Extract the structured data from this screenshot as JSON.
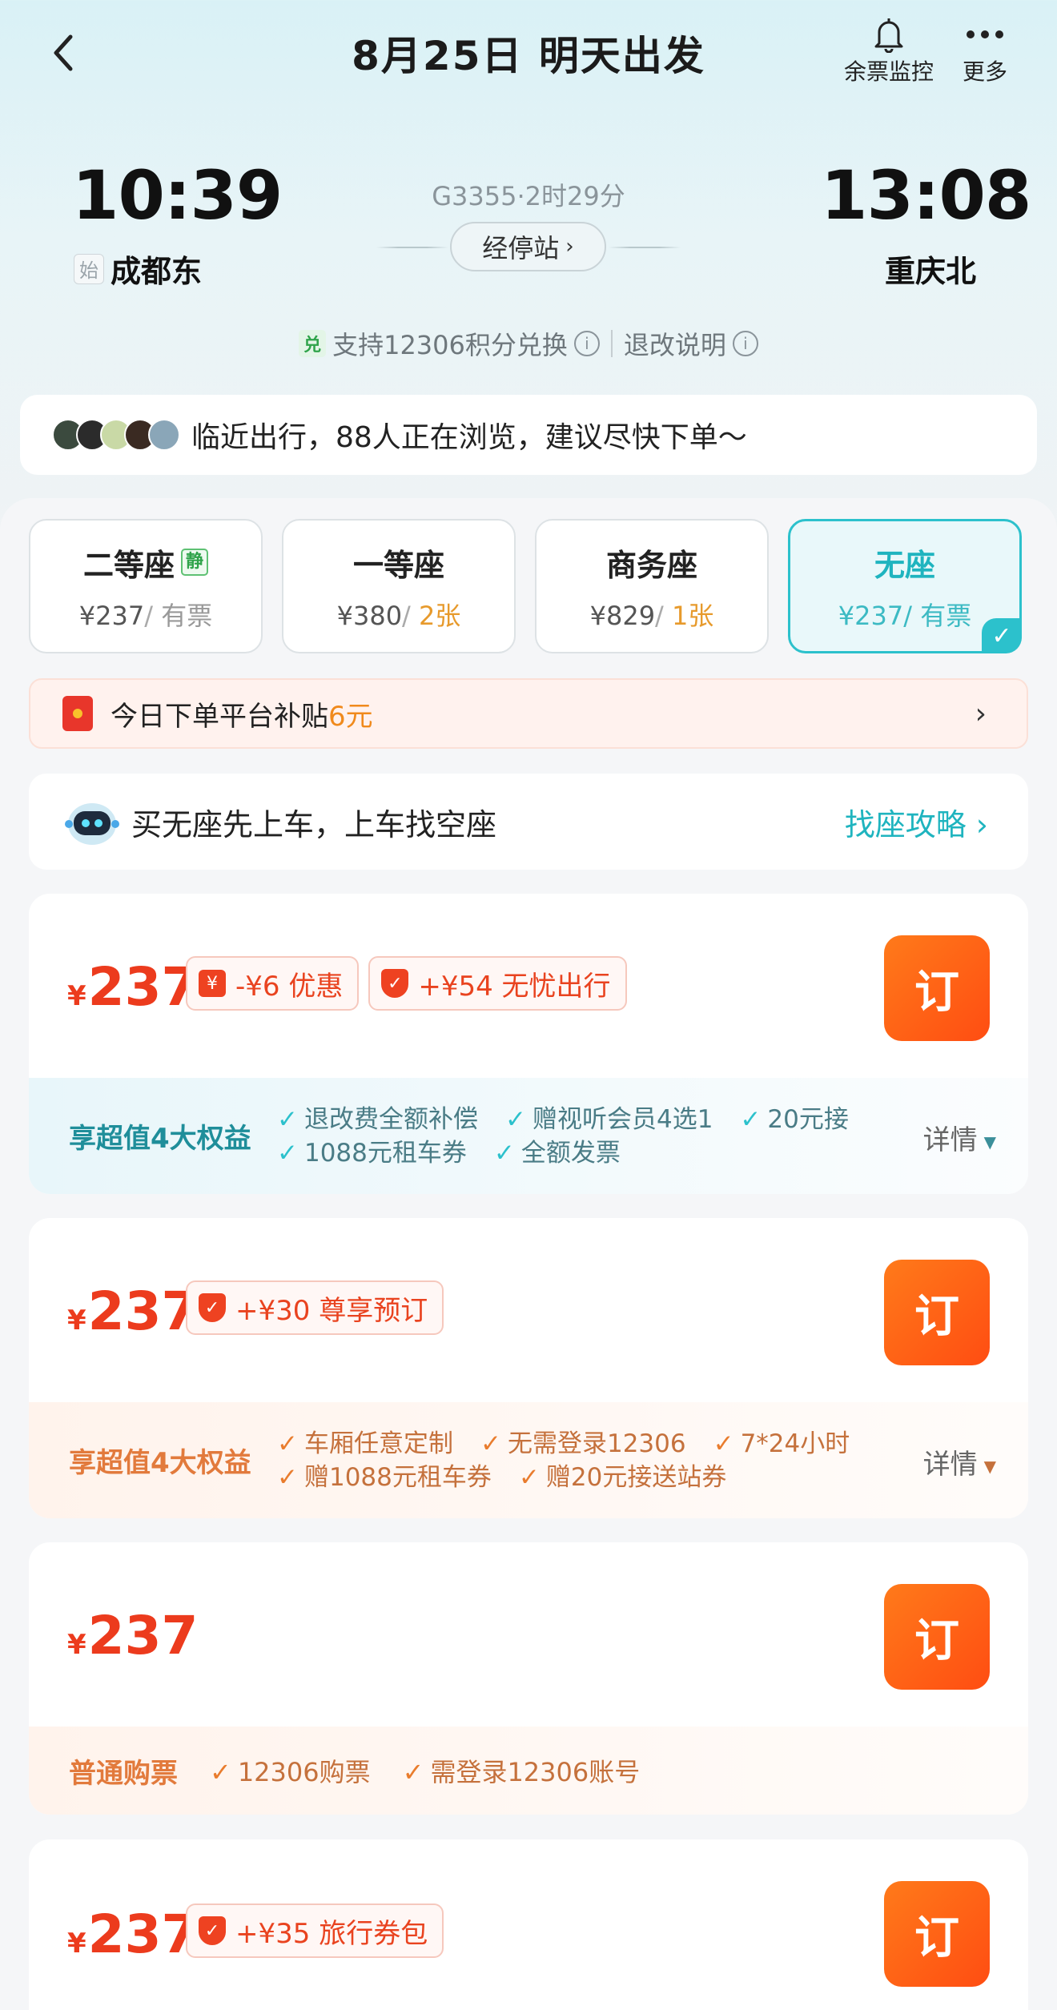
{
  "header": {
    "title": "8月25日 明天出发",
    "monitor_label": "余票监控",
    "more_label": "更多"
  },
  "train": {
    "departure_time": "10:39",
    "departure_station": "成都东",
    "start_tag": "始",
    "arrival_time": "13:08",
    "arrival_station": "重庆北",
    "train_no_duration": "G3355·2时29分",
    "stops_label": "经停站",
    "exchange_tag": "兑",
    "exchange_text": "支持12306积分兑换",
    "refund_text": "退改说明"
  },
  "browse_banner": {
    "text": "临近出行，88人正在浏览，建议尽快下单～"
  },
  "seat_tabs": [
    {
      "name": "二等座",
      "badge": "静",
      "price": "¥237",
      "sep": "/",
      "count": "有票",
      "hot": false,
      "active": false
    },
    {
      "name": "一等座",
      "badge": "",
      "price": "¥380",
      "sep": "/",
      "count": "2张",
      "hot": true,
      "active": false
    },
    {
      "name": "商务座",
      "badge": "",
      "price": "¥829",
      "sep": "/",
      "count": "1张",
      "hot": true,
      "active": false
    },
    {
      "name": "无座",
      "badge": "",
      "price": "¥237",
      "sep": "/",
      "count": "有票",
      "hot": false,
      "active": true
    }
  ],
  "subsidy": {
    "text": "今日下单平台补贴",
    "amount": "6元"
  },
  "tip": {
    "text": "买无座先上车，上车找空座",
    "guide": "找座攻略"
  },
  "offers": [
    {
      "yen": "¥",
      "price": "237",
      "tags": [
        "-¥6 优惠",
        "+¥54 无忧出行"
      ],
      "book": "订",
      "benefit_title": "享超值4大权益",
      "benefits_line1": [
        "退改费全额补偿",
        "赠视听会员4选1",
        "20元接"
      ],
      "benefits_line2": [
        "1088元租车券",
        "全额发票"
      ],
      "detail": "详情"
    },
    {
      "yen": "¥",
      "price": "237",
      "tags": [
        "+¥30 尊享预订"
      ],
      "book": "订",
      "benefit_title": "享超值4大权益",
      "benefits_line1": [
        "车厢任意定制",
        "无需登录12306",
        "7*24小时"
      ],
      "benefits_line2": [
        "赠1088元租车券",
        "赠20元接送站券"
      ],
      "detail": "详情"
    },
    {
      "yen": "¥",
      "price": "237",
      "book": "订",
      "plain_title": "普通购票",
      "plain_items": [
        "12306购票",
        "需登录12306账号"
      ]
    },
    {
      "yen": "¥",
      "price": "237",
      "tags": [
        "+¥35 旅行券包"
      ],
      "book": "订"
    }
  ]
}
